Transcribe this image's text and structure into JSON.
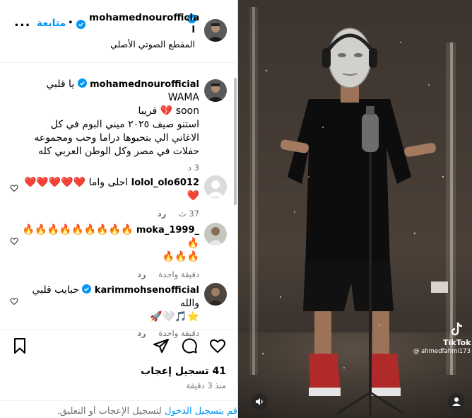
{
  "header": {
    "username_line1": "mohamednourofficia",
    "username_line2": "l",
    "follow_label": "متابعة",
    "dot": "•",
    "more": "...",
    "audio_label": "المقطع الصوتي الأصلي"
  },
  "caption": {
    "username": "mohamednourofficial",
    "line1": "يا قلبي WAMA",
    "line2": "soon 💔 قريبا",
    "line3": "استنو صيف ٢٠٢٥ ميني البوم في كل",
    "line4": "الاغاني الي بتحبوها دراما وحب ومجموعه",
    "line5": "حفلات في مصر وكل الوطن العربي كله",
    "time": "3 د"
  },
  "comments": [
    {
      "username": "lolol_olo6012",
      "text": "احلى واما ❤️❤️❤️❤️❤️❤️",
      "time": "37 ث",
      "reply": "رد"
    },
    {
      "username": "moka_1999_",
      "text_line1": "🔥🔥🔥🔥🔥🔥🔥🔥🔥🔥",
      "text_line2": "🔥🔥🔥",
      "time": "دقيقة واحدة",
      "reply": "رد"
    },
    {
      "username": "karimmohsenofficial",
      "text_line1": "حبايب قلبي والله",
      "text_line2": "⭐🎵🤍🚀",
      "time": "دقيقة واحدة",
      "reply": "رد"
    }
  ],
  "actions": {
    "likes": "41 تسجيل إعجاب",
    "post_time": "منذ 3 دقيقة"
  },
  "footer": {
    "login_link": "قم بتسجيل الدخول",
    "login_rest": " لتسجيل الإعجاب أو التعليق."
  },
  "video": {
    "tiktok_label": "TikTok",
    "tiktok_handle": "@ ahmedfahmi173"
  },
  "colors": {
    "link": "#0095f6",
    "verified": "#0095f6",
    "muted": "#737373",
    "border": "#dbdbdb"
  },
  "icons": [
    "more-icon",
    "verified-icon",
    "heart-icon",
    "comment-icon",
    "share-icon",
    "bookmark-icon",
    "sound-icon",
    "user-icon",
    "tiktok-icon"
  ]
}
